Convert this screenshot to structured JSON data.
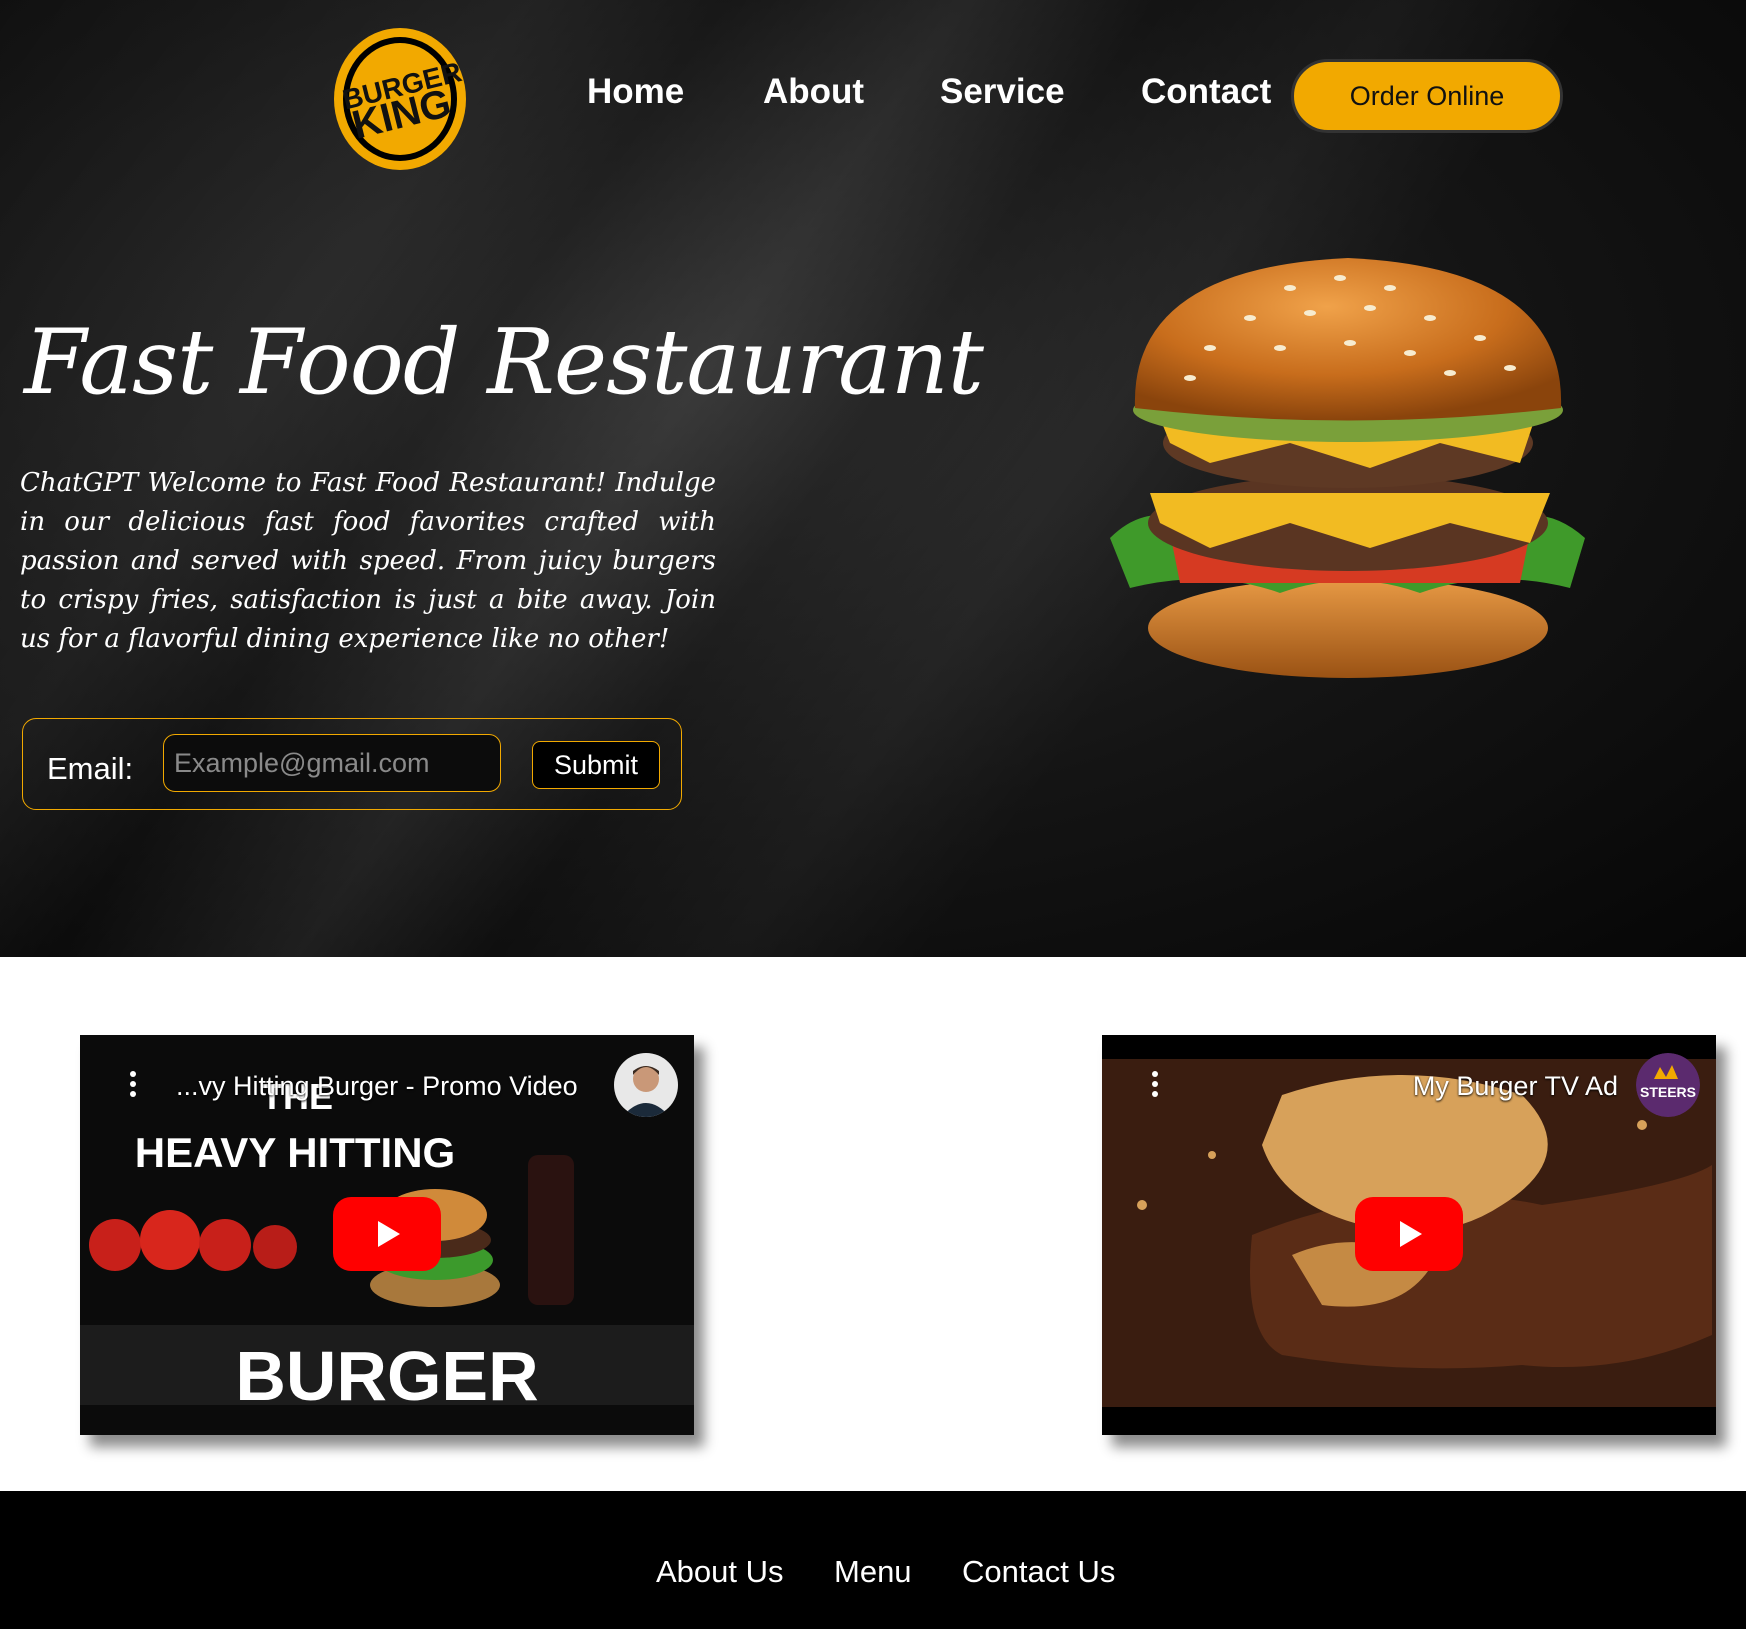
{
  "brand": {
    "logo_line1": "BURGER",
    "logo_line2": "KING",
    "accent_color": "#f2a900"
  },
  "nav": {
    "links": [
      {
        "label": "Home"
      },
      {
        "label": "About"
      },
      {
        "label": "Service"
      },
      {
        "label": "Contact"
      }
    ],
    "cta_label": "Order Online"
  },
  "hero": {
    "title": "Fast Food Restaurant",
    "description": "ChatGPT Welcome to Fast Food Restaurant! Indulge in our delicious fast food favorites crafted with passion and served with speed. From juicy burgers to crispy fries, satisfaction is just a bite away. Join us for a flavorful dining experience like no other!",
    "image_icon": "burger-photo"
  },
  "email_form": {
    "label": "Email:",
    "placeholder": "Example@gmail.com",
    "value": "",
    "submit_label": "Submit"
  },
  "videos": [
    {
      "title": "...vy Hitting Burger - Promo Video",
      "thumb_line1": "THE",
      "thumb_line2": "HEAVY HITTING",
      "thumb_line3": "BURGER",
      "channel_icon": "person-avatar"
    },
    {
      "title": "My Burger TV Ad",
      "channel_label": "STEERS",
      "channel_icon": "steers-logo"
    }
  ],
  "footer": {
    "links": [
      {
        "label": "About Us"
      },
      {
        "label": "Menu"
      },
      {
        "label": "Contact Us"
      }
    ]
  }
}
